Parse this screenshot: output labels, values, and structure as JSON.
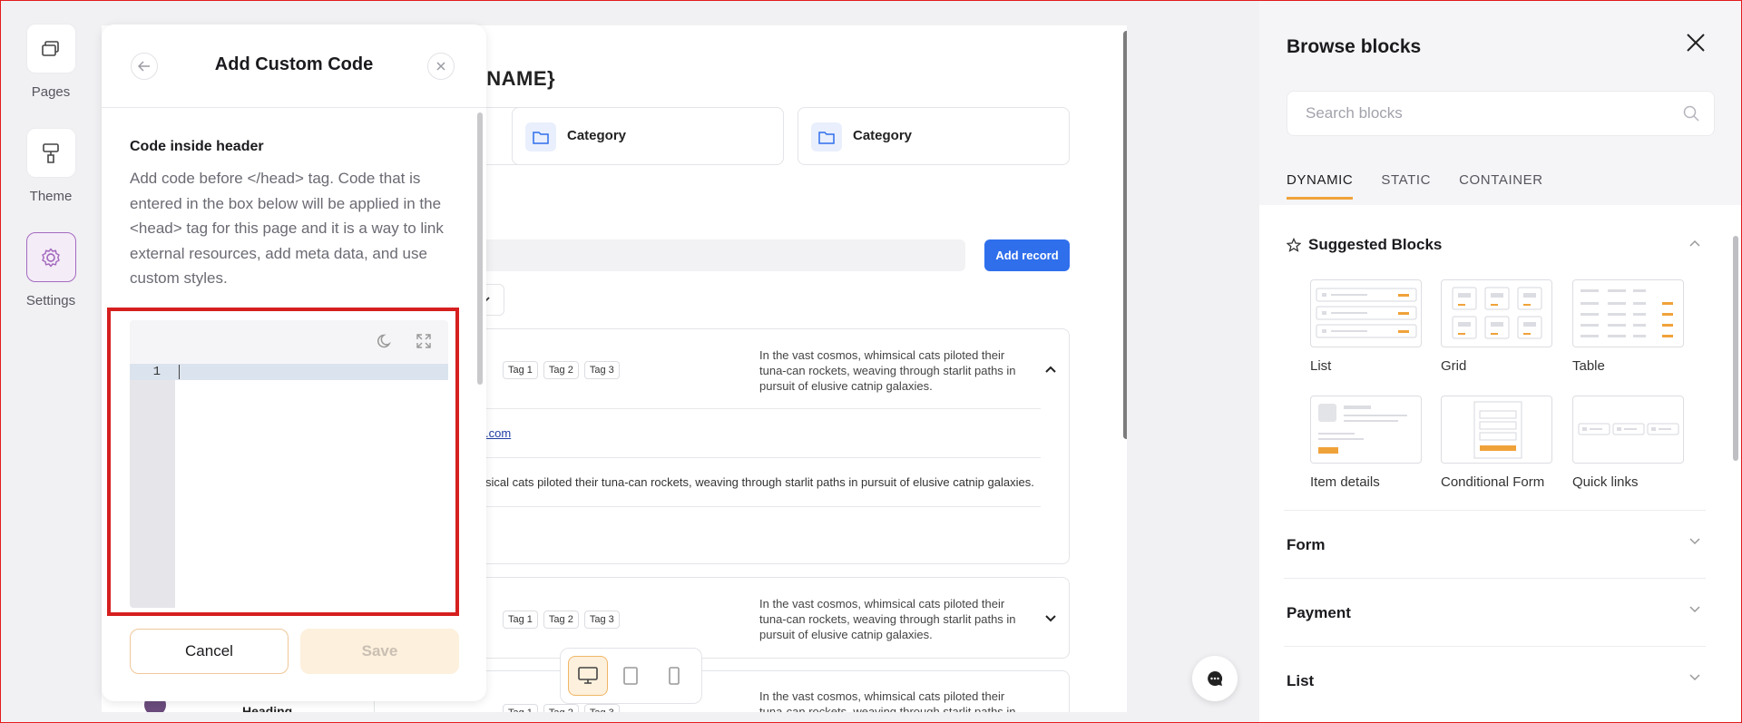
{
  "rail": {
    "pages": "Pages",
    "theme": "Theme",
    "settings": "Settings"
  },
  "canvas": {
    "title_fragment": "R:NAME}",
    "categories": [
      "Category",
      "Category"
    ],
    "add_record": "Add record",
    "tags": [
      "Tag 1",
      "Tag 2",
      "Tag 3"
    ],
    "description": "In the vast cosmos, whimsical cats piloted their tuna-can rockets, weaving through starlit paths in pursuit of elusive catnip galaxies.",
    "link_fragment": ".com",
    "long_text_fragment": "sical cats piloted their tuna-can rockets, weaving through starlit paths in pursuit of elusive catnip galaxies.",
    "heading_fragment": "Heading"
  },
  "modal": {
    "title": "Add Custom Code",
    "section_title": "Code inside header",
    "section_desc": "Add code before </head> tag. Code that is entered in the box below will be applied in the <head> tag for this page and it is a way to link external resources, add meta data, and use custom styles.",
    "line_number": "1",
    "code_value": "",
    "cancel": "Cancel",
    "save": "Save"
  },
  "panel": {
    "title": "Browse blocks",
    "search_placeholder": "Search blocks",
    "tabs": [
      "DYNAMIC",
      "STATIC",
      "CONTAINER"
    ],
    "active_tab": "DYNAMIC",
    "suggested_title": "Suggested Blocks",
    "blocks": [
      "List",
      "Grid",
      "Table",
      "Item details",
      "Conditional Form",
      "Quick links"
    ],
    "accordions": [
      "Form",
      "Payment",
      "List"
    ]
  },
  "colors": {
    "accent": "#f0a23a",
    "primary_button": "#2f6fec",
    "highlight_box": "#d61f1f",
    "settings_active": "#a46bbf"
  }
}
